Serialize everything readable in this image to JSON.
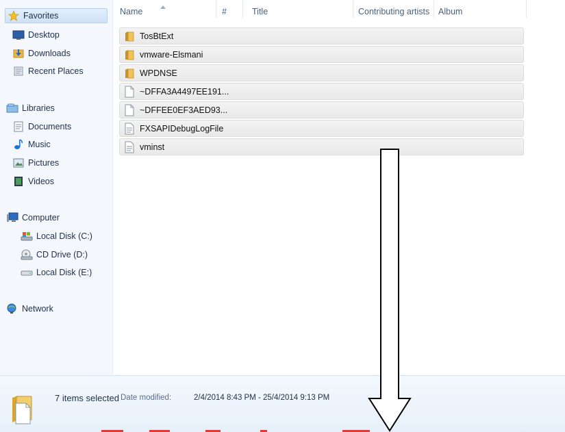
{
  "nav": {
    "favorites": {
      "label": "Favorites",
      "icon": "star-icon"
    },
    "favorites_items": [
      {
        "label": "Desktop",
        "icon": "desktop-icon"
      },
      {
        "label": "Downloads",
        "icon": "downloads-icon"
      },
      {
        "label": "Recent Places",
        "icon": "recent-places-icon"
      }
    ],
    "libraries": {
      "label": "Libraries",
      "icon": "libraries-icon"
    },
    "libraries_items": [
      {
        "label": "Documents",
        "icon": "documents-icon"
      },
      {
        "label": "Music",
        "icon": "music-icon"
      },
      {
        "label": "Pictures",
        "icon": "pictures-icon"
      },
      {
        "label": "Videos",
        "icon": "videos-icon"
      }
    ],
    "computer": {
      "label": "Computer",
      "icon": "computer-icon"
    },
    "computer_items": [
      {
        "label": "Local Disk (C:)",
        "icon": "local-disk-icon"
      },
      {
        "label": "CD Drive (D:)",
        "icon": "cd-drive-icon"
      },
      {
        "label": "Local Disk (E:)",
        "icon": "drive-icon"
      }
    ],
    "network": {
      "label": "Network",
      "icon": "network-icon"
    }
  },
  "columns": {
    "name": "Name",
    "number": "#",
    "title": "Title",
    "contributing_artists": "Contributing artists",
    "album": "Album"
  },
  "files": [
    {
      "name": "TosBtExt",
      "type": "folder"
    },
    {
      "name": "vmware-Elsmani",
      "type": "folder"
    },
    {
      "name": "WPDNSE",
      "type": "folder"
    },
    {
      "name": "~DFFA3A4497EE191...",
      "type": "file"
    },
    {
      "name": "~DFFEE0EF3AED93...",
      "type": "file"
    },
    {
      "name": "FXSAPIDebugLogFile",
      "type": "file"
    },
    {
      "name": "vminst",
      "type": "file"
    }
  ],
  "details": {
    "selection": "7 items selected",
    "date_label": "Date modified:",
    "date_value": "2/4/2014 8:43 PM - 25/4/2014 9:13 PM"
  },
  "colors": {
    "selection_highlight": "#cfe1f7",
    "folder": "#e8b64a",
    "annotation_arrow": "#000000"
  }
}
